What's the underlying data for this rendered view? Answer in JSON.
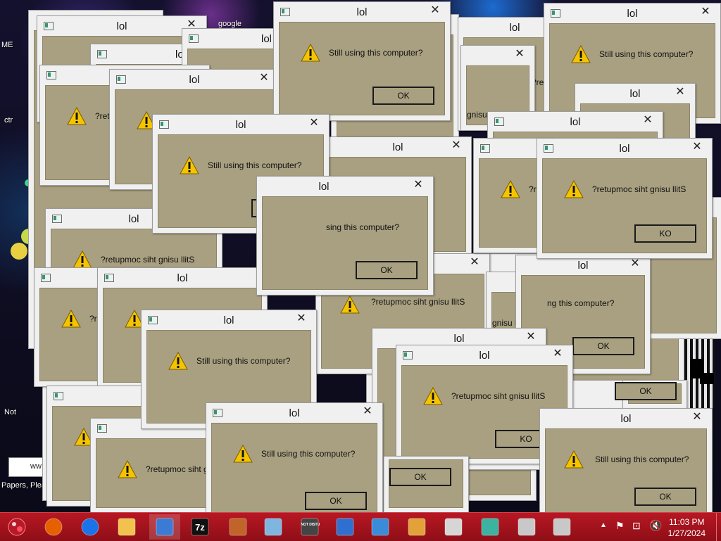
{
  "dialog": {
    "title": "lol",
    "message_normal": "Still using this computer?",
    "message_reversed": "?retupmoc siht gnisu llitS",
    "message_partial": "sing this computer?",
    "message_partial2": "ng this computer?",
    "message_reversed_partial": "gnisu llitS",
    "message_reversed_partial2": "?retup",
    "message_reversed_partial3": "?re",
    "ok": "OK",
    "ok_reversed": "KO",
    "close_glyph": "✕"
  },
  "desktop": {
    "labels": [
      "ME",
      "ctr",
      "Not",
      "Papers, Plea",
      "ww",
      "google"
    ]
  },
  "taskbar": {
    "apps": [
      {
        "name": "firefox-icon",
        "color": "#e66000"
      },
      {
        "name": "chrome-icon",
        "color": "#1a73e8"
      },
      {
        "name": "file-explorer-icon",
        "color": "#f3c24e"
      },
      {
        "name": "pin-app-icon",
        "color": "#3b7bd6"
      },
      {
        "name": "7zip-icon",
        "color": "#111111"
      },
      {
        "name": "chicken-game-icon",
        "color": "#c0642a"
      },
      {
        "name": "notepad-icon",
        "color": "#7fb6e0"
      },
      {
        "name": "do-not-disturb-icon",
        "color": "#444444"
      },
      {
        "name": "wordpad-icon",
        "color": "#2f6fd0"
      },
      {
        "name": "window-app-icon",
        "color": "#3a8bd8"
      },
      {
        "name": "paint-icon",
        "color": "#e3a13a"
      },
      {
        "name": "calculator-icon",
        "color": "#d6d6d6"
      },
      {
        "name": "3d-blocks-icon",
        "color": "#3cb3a0"
      },
      {
        "name": "server-app-icon",
        "color": "#c8c8c8"
      },
      {
        "name": "server-app-icon-2",
        "color": "#c8c8c8"
      }
    ],
    "dnd_label": "DO NOT DISTURB",
    "sevenzip_label": "7z",
    "clock_time": "11:03 PM",
    "clock_date": "1/27/2024"
  },
  "colors": {
    "dialog_body": "#a9a081",
    "taskbar": "#a9141e"
  }
}
